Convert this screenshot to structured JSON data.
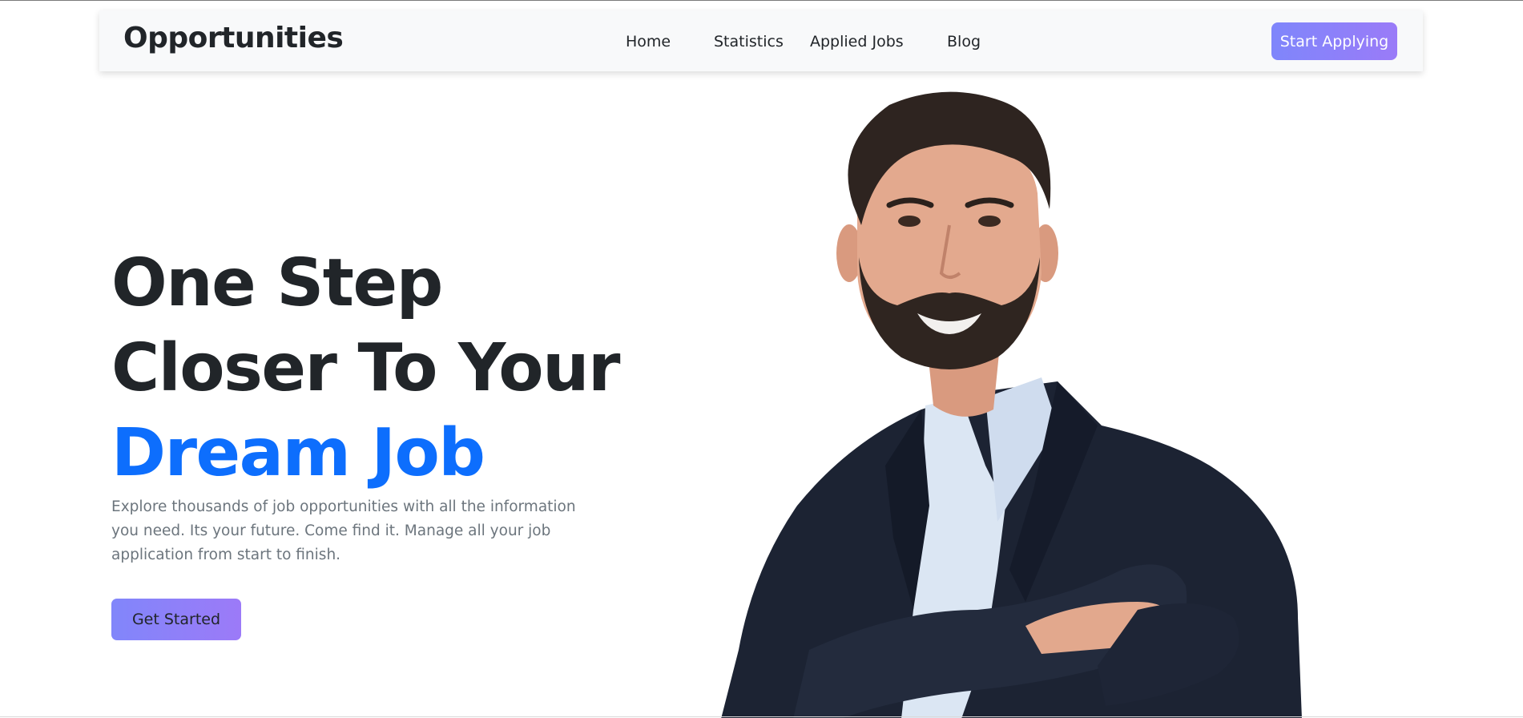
{
  "navbar": {
    "brand": "Opportunities",
    "links": [
      {
        "label": "Home"
      },
      {
        "label": "Statistics"
      },
      {
        "label": "Applied Jobs"
      },
      {
        "label": "Blog"
      }
    ],
    "cta_label": "Start Applying"
  },
  "hero": {
    "title_line1": "One Step",
    "title_line2": "Closer To Your",
    "title_accent": "Dream Job",
    "description": "Explore thousands of job opportunities with all the information you need. Its your future. Come find it. Manage all your job application from start to finish.",
    "button_label": "Get Started",
    "image_alt": "smiling man in suit with crossed arms"
  },
  "colors": {
    "accent_blue": "#0d6efd",
    "button_gradient_start": "#7f86fb",
    "button_gradient_end": "#9a7bf8",
    "heading": "#212529",
    "muted_text": "#6c757d",
    "navbar_bg": "#f8f9fa"
  }
}
